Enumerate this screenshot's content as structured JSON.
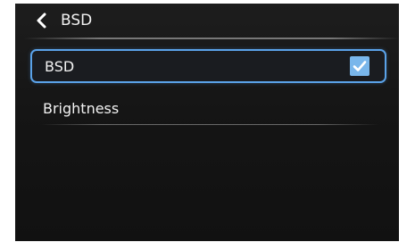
{
  "header": {
    "back_icon": "chevron-left-icon",
    "title": "BSD"
  },
  "menu": {
    "items": [
      {
        "label": "BSD",
        "checked": true,
        "selected": true
      },
      {
        "label": "Brightness"
      }
    ]
  },
  "colors": {
    "background": "#151515",
    "selection_border": "#5aa2e8",
    "checkbox_fill": "#79b6eb",
    "text": "#f2f2f2"
  }
}
